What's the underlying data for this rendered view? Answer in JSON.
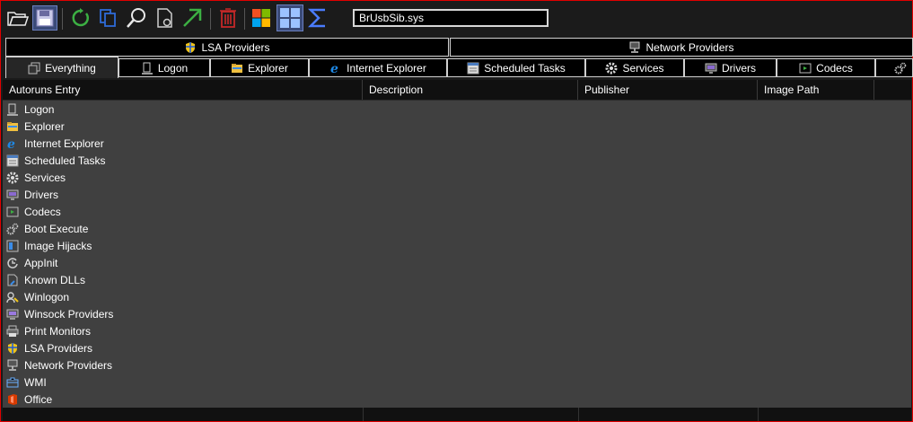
{
  "toolbar": {
    "icons": [
      "open-folder-icon",
      "save-icon",
      "refresh-icon",
      "copy-icon",
      "find-icon",
      "properties-icon",
      "jump-icon",
      "delete-icon",
      "windows-logo-icon",
      "grid-view-icon",
      "sigma-icon"
    ],
    "filter_value": "BrUsbSib.sys"
  },
  "tabs_top": [
    {
      "label": "LSA Providers",
      "icon": "lsa-shield-icon"
    },
    {
      "label": "Network Providers",
      "icon": "network-icon"
    }
  ],
  "tabs_bottom": [
    {
      "label": "Everything",
      "icon": "everything-icon",
      "selected": true
    },
    {
      "label": "Logon",
      "icon": "logon-icon"
    },
    {
      "label": "Explorer",
      "icon": "explorer-icon"
    },
    {
      "label": "Internet Explorer",
      "icon": "ie-icon"
    },
    {
      "label": "Scheduled Tasks",
      "icon": "scheduled-tasks-icon"
    },
    {
      "label": "Services",
      "icon": "services-icon"
    },
    {
      "label": "Drivers",
      "icon": "drivers-icon"
    },
    {
      "label": "Codecs",
      "icon": "codecs-icon"
    }
  ],
  "columns": [
    "Autoruns Entry",
    "Description",
    "Publisher",
    "Image Path"
  ],
  "entries": [
    {
      "label": "Logon",
      "icon": "logon-icon"
    },
    {
      "label": "Explorer",
      "icon": "explorer-icon"
    },
    {
      "label": "Internet Explorer",
      "icon": "ie-icon"
    },
    {
      "label": "Scheduled Tasks",
      "icon": "scheduled-tasks-icon"
    },
    {
      "label": "Services",
      "icon": "services-icon"
    },
    {
      "label": "Drivers",
      "icon": "drivers-icon"
    },
    {
      "label": "Codecs",
      "icon": "codecs-icon"
    },
    {
      "label": "Boot Execute",
      "icon": "boot-execute-icon"
    },
    {
      "label": "Image Hijacks",
      "icon": "image-hijacks-icon"
    },
    {
      "label": "AppInit",
      "icon": "appinit-icon"
    },
    {
      "label": "Known DLLs",
      "icon": "known-dlls-icon"
    },
    {
      "label": "Winlogon",
      "icon": "winlogon-icon"
    },
    {
      "label": "Winsock Providers",
      "icon": "winsock-icon"
    },
    {
      "label": "Print Monitors",
      "icon": "print-monitors-icon"
    },
    {
      "label": "LSA Providers",
      "icon": "lsa-shield-icon"
    },
    {
      "label": "Network Providers",
      "icon": "network-icon"
    },
    {
      "label": "WMI",
      "icon": "wmi-icon"
    },
    {
      "label": "Office",
      "icon": "office-icon"
    }
  ],
  "colors": {
    "window_border": "#e00000",
    "list_bg": "#404040",
    "header_bg": "#101010"
  }
}
